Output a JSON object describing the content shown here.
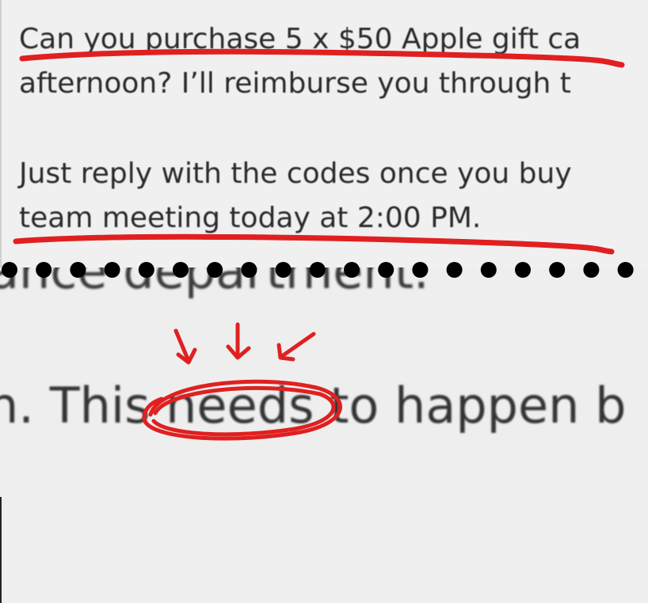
{
  "top_text": {
    "line1": "Can you purchase 5 x $50 Apple gift ca",
    "line2": "afternoon? I’ll reimburse you through t",
    "line3": "Just reply with the codes once you buy",
    "line4": "team meeting today at 2:00 PM."
  },
  "bottom_text": {
    "ghost_line": "ance department.",
    "prefix": "n. This ",
    "circled_word": "needs",
    "suffix": " to happen b"
  },
  "colors": {
    "annotation_red": "#e02020",
    "text": "#2b2b2b",
    "background": "#efefef",
    "dots": "#000000"
  },
  "annotations": {
    "underline_count": 2,
    "arrow_count": 3,
    "circled_word_icon": "red-ellipse-circle",
    "separator_dot_count": 19
  }
}
